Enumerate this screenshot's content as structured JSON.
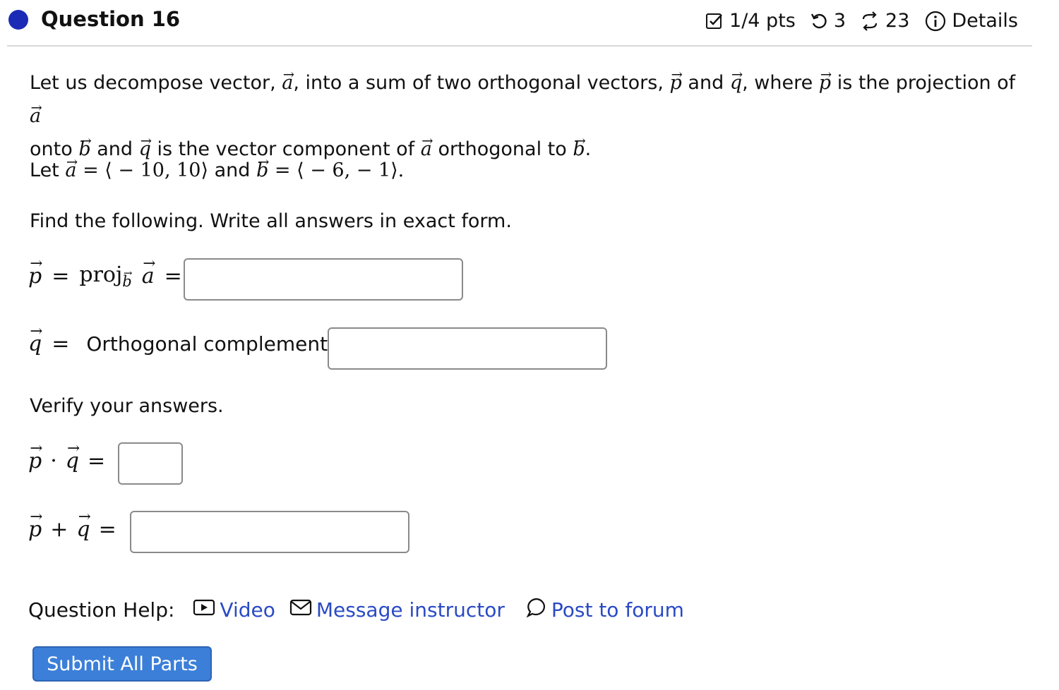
{
  "header": {
    "title": "Question 16",
    "points": "1/4 pts",
    "attempts": "3",
    "regen": "23",
    "details": "Details"
  },
  "problem": {
    "line1_a": "Let us decompose vector,",
    "line1_b": ", into a sum of two orthogonal vectors,",
    "line1_c": "and",
    "line1_d": ", where",
    "line1_e": "is the projection of",
    "line2_a": "onto",
    "line2_b": "and",
    "line2_c": "is the vector component of",
    "line2_d": "orthogonal to",
    "given_let": "Let",
    "given_a_value": "= ⟨ − 10, 10⟩",
    "given_and": "and",
    "given_b_value": "= ⟨ − 6,  − 1⟩.",
    "instructions": "Find the following. Write all answers in exact form.",
    "verify": "Verify your answers."
  },
  "answers": {
    "proj_label": "proj",
    "orth_label": "Orthogonal complement =",
    "proj_value": "",
    "orth_value": "",
    "dot_value": "",
    "sum_value": ""
  },
  "help": {
    "label": "Question Help:",
    "video": "Video",
    "message": "Message instructor",
    "forum": "Post to forum"
  },
  "submit_label": "Submit All Parts",
  "colors": {
    "accent": "#1c2bb5",
    "link": "#2a4ac4",
    "button": "#3b7fd8"
  }
}
